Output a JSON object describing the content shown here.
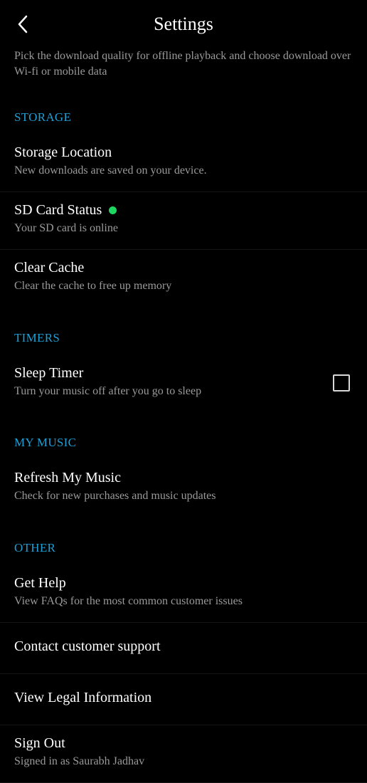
{
  "header": {
    "title": "Settings"
  },
  "intro": "Pick the download quality for offline playback and choose download over Wi-fi or mobile data",
  "sections": {
    "storage": {
      "header": "STORAGE",
      "storage_location": {
        "title": "Storage Location",
        "sub": "New downloads are saved on your device."
      },
      "sd_card": {
        "title": "SD Card Status",
        "sub": "Your SD card is online"
      },
      "clear_cache": {
        "title": "Clear Cache",
        "sub": "Clear the cache to free up memory"
      }
    },
    "timers": {
      "header": "TIMERS",
      "sleep_timer": {
        "title": "Sleep Timer",
        "sub": "Turn your music off after you go to sleep"
      }
    },
    "my_music": {
      "header": "My MUSIC",
      "refresh": {
        "title": "Refresh My Music",
        "sub": "Check for new purchases and music updates"
      }
    },
    "other": {
      "header": "OTHER",
      "get_help": {
        "title": "Get Help",
        "sub": "View FAQs for the most common customer issues"
      },
      "contact": {
        "title": "Contact customer support"
      },
      "legal": {
        "title": "View Legal Information"
      },
      "signout": {
        "title": "Sign Out",
        "sub": "Signed in as Saurabh Jadhav"
      }
    }
  }
}
